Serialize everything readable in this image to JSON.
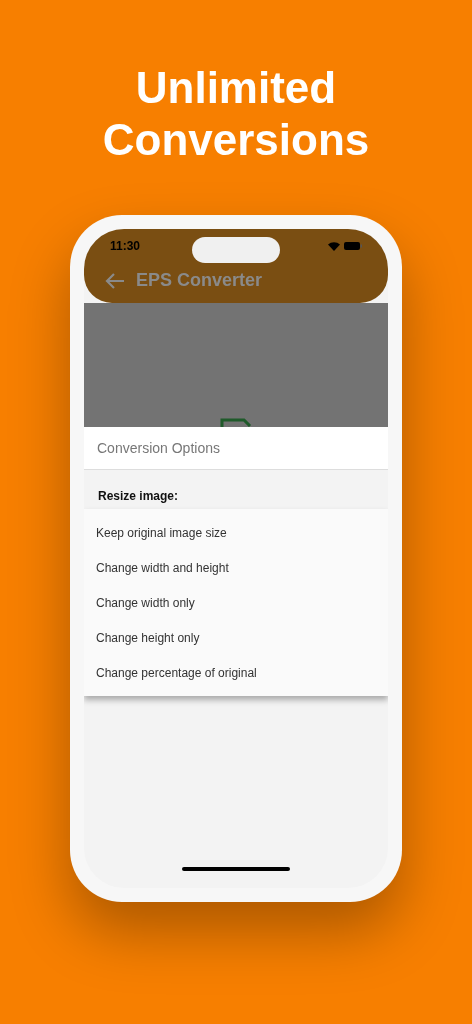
{
  "headline": [
    "Unlimited",
    "Conversions"
  ],
  "status_bar": {
    "time": "11:30"
  },
  "app_bar": {
    "title": "EPS Converter"
  },
  "sheet": {
    "title": "Conversion Options",
    "section_label": "Resize image:"
  },
  "menu": {
    "items": [
      {
        "label": "Keep original image size"
      },
      {
        "label": "Change width and height"
      },
      {
        "label": "Change width only"
      },
      {
        "label": "Change height only"
      },
      {
        "label": "Change percentage of original"
      }
    ]
  }
}
